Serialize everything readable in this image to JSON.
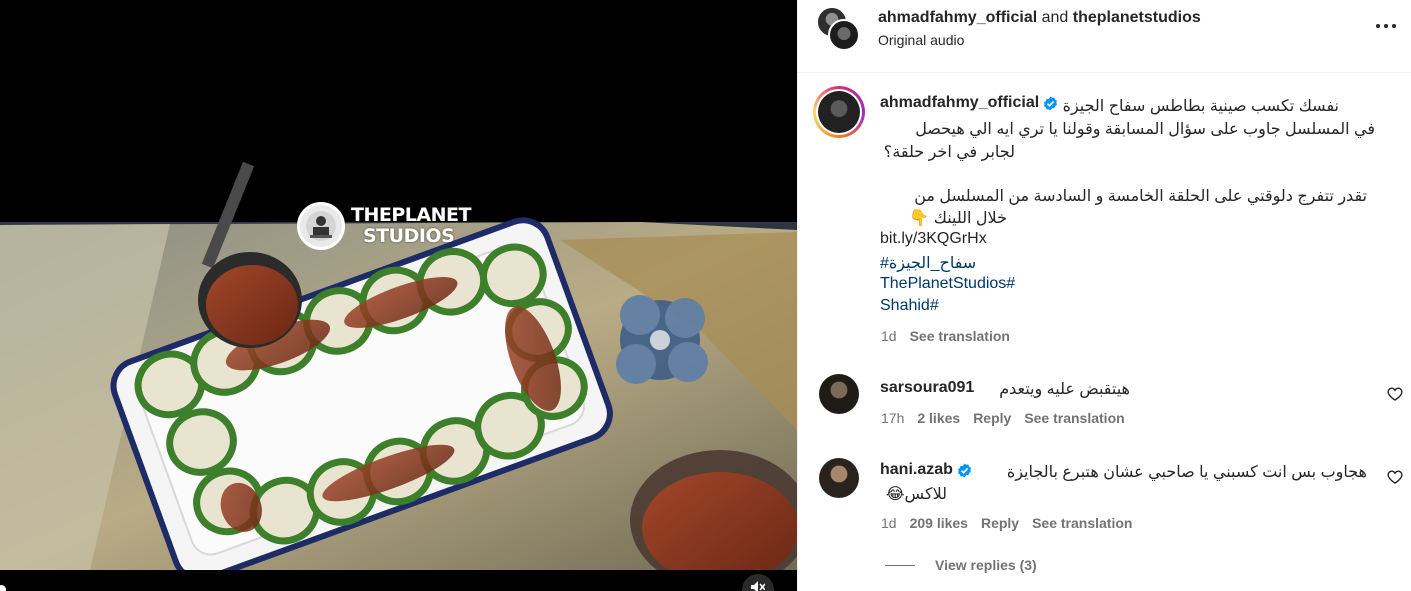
{
  "media": {
    "watermark_line1": "THEPLANET",
    "watermark_line2": "STUDIOS"
  },
  "header": {
    "user1": "ahmadfahmy_official",
    "conjunction": "and",
    "user2": "theplanetstudios",
    "audio": "Original audio"
  },
  "caption": {
    "username": "ahmadfahmy_official",
    "line1": "نفسك تكسب صينية بطاطس سفاح الجيزة",
    "line2": "في المسلسل جاوب على سؤال المسابقة وقولنا يا تري ايه الي هيحصل",
    "line3": "لجابر في اخر حلقة؟",
    "line4": "تقدر تتفرج دلوقتي على الحلقة الخامسة و السادسة من المسلسل من",
    "line5": "خلال اللينك 👇",
    "link": "bit.ly/3KQGrHx",
    "hashtag1": "#سفاح_الجيزة",
    "hashtag2": "ThePlanetStudios#",
    "hashtag3": "Shahid#",
    "time": "1d",
    "see_translation": "See translation"
  },
  "comments": [
    {
      "username": "sarsoura091",
      "text": "هيتقبض عليه ويتعدم",
      "time": "17h",
      "likes": "2 likes",
      "reply": "Reply",
      "see_translation": "See translation"
    },
    {
      "username": "hani.azab",
      "text_line1": "هجاوب بس انت كسبني يا صاحبي عشان هتبرع بالجايزة",
      "text_line2": "للاكس😂",
      "time": "1d",
      "likes": "209 likes",
      "reply": "Reply",
      "see_translation": "See translation"
    }
  ],
  "view_replies": "View replies (3)",
  "colors": {
    "verified": "#0095f6",
    "link": "#00376b",
    "muted_text": "#737373"
  }
}
